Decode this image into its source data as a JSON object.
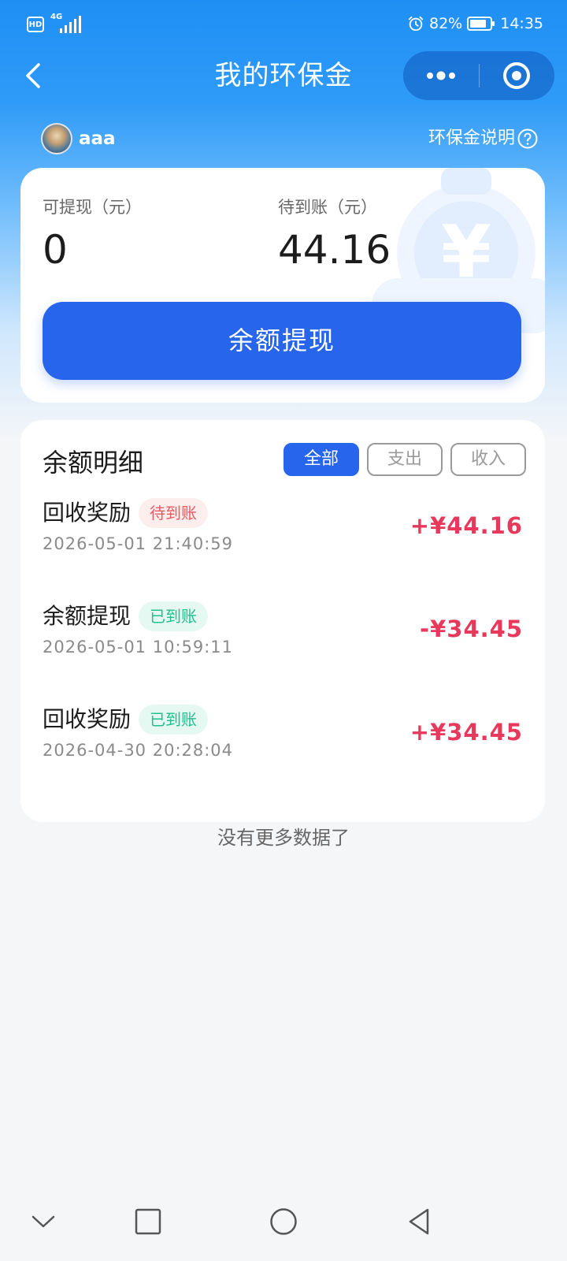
{
  "status_bar": {
    "hd": "HD",
    "network": "4G",
    "battery": "82%",
    "time": "14:35"
  },
  "nav": {
    "title": "我的环保金"
  },
  "user": {
    "name": "aaa",
    "help_label": "环保金说明"
  },
  "balance": {
    "withdrawable_label": "可提现（元）",
    "withdrawable_value": "0",
    "pending_label": "待到账（元）",
    "pending_value": "44.16",
    "withdraw_button": "余额提现",
    "watermark_symbol": "¥"
  },
  "details": {
    "title": "余额明细",
    "tabs": [
      {
        "label": "全部",
        "active": true
      },
      {
        "label": "支出",
        "active": false
      },
      {
        "label": "收入",
        "active": false
      }
    ],
    "transactions": [
      {
        "name": "回收奖励",
        "status": "待到账",
        "time": "2026-05-01 21:40:59",
        "amount": "+¥44.16"
      },
      {
        "name": "余额提现",
        "status": "已到账",
        "time": "2026-05-01 10:59:11",
        "amount": "-¥34.45"
      },
      {
        "name": "回收奖励",
        "status": "已到账",
        "time": "2026-04-30 20:28:04",
        "amount": "+¥34.45"
      }
    ],
    "no_more": "没有更多数据了"
  },
  "colors": {
    "accent": "#2765ec",
    "amount": "#e8385b",
    "pending_badge": "#e65a61",
    "done_badge": "#1fbf8e"
  }
}
